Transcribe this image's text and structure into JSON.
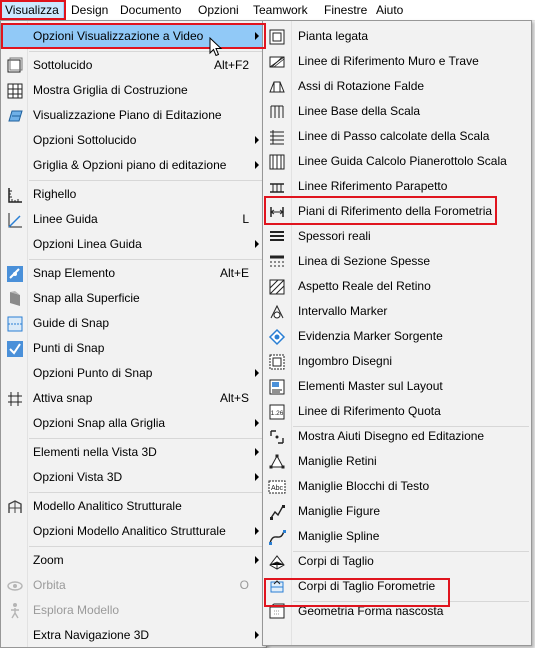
{
  "menubar": {
    "items": [
      "Visualizza",
      "Design",
      "Documento",
      "Opzioni",
      "Teamwork",
      "Finestre",
      "Aiuto"
    ]
  },
  "main_menu": {
    "items": [
      {
        "label": "Opzioni Visualizzazione a Video",
        "submenu": true,
        "highlighted": true,
        "icon": "none"
      },
      {
        "label": "Sottolucido",
        "shortcut": "Alt+F2",
        "icon": "trace-icon"
      },
      {
        "label": "Mostra Griglia di Costruzione",
        "icon": "grid-icon"
      },
      {
        "label": "Visualizzazione Piano di Editazione",
        "icon": "editing-plane-icon"
      },
      {
        "label": "Opzioni Sottolucido",
        "submenu": true
      },
      {
        "label": "Griglia & Opzioni piano di editazione",
        "submenu": true
      },
      {
        "label": "Righello",
        "icon": "ruler-icon"
      },
      {
        "label": "Linee Guida",
        "shortcut": "L",
        "icon": "guide-lines-icon"
      },
      {
        "label": "Opzioni Linea Guida",
        "submenu": true
      },
      {
        "label": "Snap Elemento",
        "shortcut": "Alt+E",
        "icon": "snap-element-icon"
      },
      {
        "label": "Snap alla Superficie",
        "icon": "snap-surface-icon"
      },
      {
        "label": "Guide di Snap",
        "icon": "snap-guides-icon"
      },
      {
        "label": "Punti di Snap",
        "icon": "snap-points-icon"
      },
      {
        "label": "Opzioni Punto di Snap",
        "submenu": true
      },
      {
        "label": "Attiva snap",
        "shortcut": "Alt+S",
        "icon": "activate-snap-icon"
      },
      {
        "label": "Opzioni Snap alla Griglia",
        "submenu": true
      },
      {
        "label": "Elementi nella Vista 3D",
        "submenu": true
      },
      {
        "label": "Opzioni Vista 3D",
        "submenu": true
      },
      {
        "label": "Modello Analitico Strutturale",
        "icon": "structural-model-icon"
      },
      {
        "label": "Opzioni Modello Analitico Strutturale",
        "submenu": true
      },
      {
        "label": "Zoom",
        "submenu": true
      },
      {
        "label": "Orbita",
        "shortcut": "O",
        "disabled": true,
        "icon": "orbit-icon"
      },
      {
        "label": "Esplora Modello",
        "disabled": true,
        "icon": "explore-icon"
      },
      {
        "label": "Extra Navigazione 3D",
        "submenu": true
      }
    ]
  },
  "submenu": {
    "items": [
      {
        "label": "Pianta legata",
        "icon": "tied-plan-icon"
      },
      {
        "label": "Linee di Riferimento Muro e Trave",
        "icon": "wall-beam-reference-icon"
      },
      {
        "label": "Assi di Rotazione Falde",
        "icon": "roof-pivot-icon"
      },
      {
        "label": "Linee Base della Scala",
        "icon": "stair-baseline-icon"
      },
      {
        "label": "Linee di Passo calcolate della Scala",
        "icon": "stair-walkline-icon"
      },
      {
        "label": "Linee Guida Calcolo Pianerottolo Scala",
        "icon": "landing-guide-icon"
      },
      {
        "label": "Linee Riferimento Parapetto",
        "icon": "railing-reference-icon"
      },
      {
        "label": "Piani di Riferimento della Forometria",
        "icon": "opening-reference-plane-icon",
        "boxed": true
      },
      {
        "label": "Spessori reali",
        "icon": "true-thickness-icon"
      },
      {
        "label": "Linea di Sezione Spesse",
        "icon": "bold-section-line-icon"
      },
      {
        "label": "Aspetto Reale del Retino",
        "icon": "fill-vectorial-icon"
      },
      {
        "label": "Intervallo Marker",
        "icon": "marker-range-icon"
      },
      {
        "label": "Evidenzia Marker Sorgente",
        "icon": "highlight-marker-icon"
      },
      {
        "label": "Ingombro Disegni",
        "icon": "drawing-frame-icon"
      },
      {
        "label": "Elementi Master sul Layout",
        "icon": "master-layout-icon"
      },
      {
        "label": "Linee di Riferimento Quota",
        "icon": "dimension-reference-icon"
      },
      {
        "label": "Mostra Aiuti Disegno ed Editazione",
        "icon": "drawing-aids-icon"
      },
      {
        "label": "Maniglie Retini",
        "icon": "fill-handles-icon"
      },
      {
        "label": "Maniglie Blocchi di Testo",
        "icon": "text-handles-icon"
      },
      {
        "label": "Maniglie Figure",
        "icon": "figure-handles-icon"
      },
      {
        "label": "Maniglie Spline",
        "icon": "spline-handles-icon"
      },
      {
        "label": "Corpi di Taglio",
        "icon": "cutting-body-icon"
      },
      {
        "label": "Corpi di Taglio Forometrie",
        "icon": "opening-cutting-body-icon",
        "boxed": true
      },
      {
        "label": "Geometria Forma nascosta",
        "icon": "hidden-geometry-icon"
      }
    ]
  },
  "colors": {
    "highlight": "#91c9f7",
    "annotation_box": "#e0141e",
    "menubar_active": "#cce8ff"
  }
}
